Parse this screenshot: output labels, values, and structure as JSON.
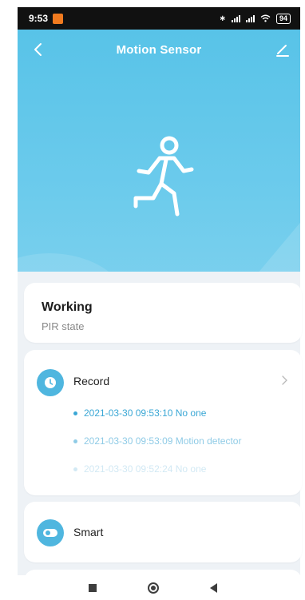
{
  "status_bar": {
    "time": "9:53",
    "battery": "94"
  },
  "header": {
    "title": "Motion Sensor"
  },
  "state_card": {
    "value": "Working",
    "label": "PIR state"
  },
  "record_card": {
    "label": "Record",
    "entries": [
      "2021-03-30 09:53:10 No one",
      "2021-03-30 09:53:09 Motion detector",
      "2021-03-30 09:52:24 No one"
    ]
  },
  "smart_card": {
    "label": "Smart"
  },
  "colors": {
    "accent": "#4fb6df",
    "hero_top": "#58c3e8",
    "hero_bottom": "#7dd1ee",
    "background": "#eef2f6"
  },
  "icons": {
    "back": "back-chevron-icon",
    "edit": "edit-pencil-icon",
    "sensor": "running-person-icon",
    "record": "clock-icon",
    "smart": "toggle-icon",
    "more": "chevron-right-icon"
  }
}
